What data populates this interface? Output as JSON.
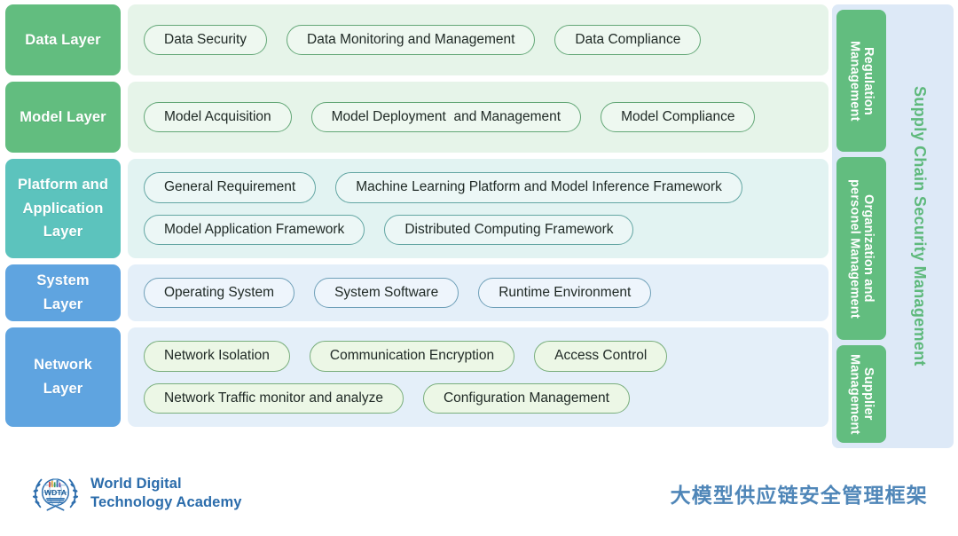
{
  "diagram": {
    "title_cn": "大模型供应链安全管理框架",
    "layers": [
      {
        "key": "data",
        "label": "Data Layer",
        "label_color": "#62bd7f",
        "body_color": "#e6f4e9",
        "items": [
          "Data Security",
          "Data Monitoring and Management",
          "Data Compliance"
        ]
      },
      {
        "key": "model",
        "label": "Model Layer",
        "label_color": "#62bd7f",
        "body_color": "#e6f4e9",
        "items": [
          "Model Acquisition",
          "Model Deployment  and Management",
          "Model Compliance"
        ]
      },
      {
        "key": "platform",
        "label": "Platform and Application Layer",
        "label_line1": "Platform and",
        "label_line2": "Application",
        "label_line3": "Layer",
        "label_color": "#5cc3bd",
        "body_color": "#e2f3f2",
        "items": [
          "General Requirement",
          "Machine Learning Platform and Model Inference Framework",
          "Model Application Framework",
          "Distributed Computing Framework"
        ]
      },
      {
        "key": "system",
        "label": "System Layer",
        "label_line1": "System",
        "label_line2": "Layer",
        "label_color": "#5fa4e0",
        "body_color": "#e4eff9",
        "items": [
          "Operating System",
          "System Software",
          "Runtime Environment"
        ]
      },
      {
        "key": "network",
        "label": "Network Layer",
        "label_line1": "Network",
        "label_line2": "Layer",
        "label_color": "#5fa4e0",
        "body_color": "#e4eff9",
        "items": [
          "Network Isolation",
          "Communication Encryption",
          "Access Control",
          "Network Traffic monitor and analyze",
          "Configuration Management"
        ]
      }
    ],
    "sidebar": {
      "panel_color": "#dde9f7",
      "title": "Supply Chain Security Management",
      "title_color": "#5eb97c",
      "boxes": [
        {
          "line1": "Regulation",
          "line2": "Management"
        },
        {
          "line1": "Organization and",
          "line2": "personel Management"
        },
        {
          "line1": "Supplier",
          "line2": "Management"
        }
      ]
    }
  },
  "footer": {
    "logo_icon": "wdta-emblem-icon",
    "logo_monogram": "WDTA",
    "brand_line1": "World Digital",
    "brand_line2": "Technology Academy",
    "brand_color": "#2b6cab",
    "doc_title": "大模型供应链安全管理框架",
    "doc_title_color": "#4f86b8"
  }
}
